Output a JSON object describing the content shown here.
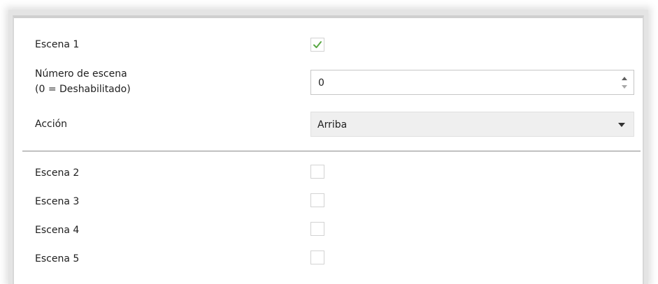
{
  "scenes": {
    "scene1": {
      "label": "Escena 1",
      "checked": true
    },
    "scene2": {
      "label": "Escena 2",
      "checked": false
    },
    "scene3": {
      "label": "Escena 3",
      "checked": false
    },
    "scene4": {
      "label": "Escena 4",
      "checked": false
    },
    "scene5": {
      "label": "Escena 5",
      "checked": false
    }
  },
  "scene_number": {
    "label_line1": "Número de escena",
    "label_line2": "(0 = Deshabilitado)",
    "value": "0"
  },
  "action": {
    "label": "Acción",
    "selected": "Arriba"
  },
  "icons": {
    "check": "checkmark-icon",
    "spin_up": "spin-up-icon",
    "spin_down": "spin-down-icon",
    "dropdown": "chevron-down-icon"
  },
  "colors": {
    "check_green": "#5aa845",
    "select_bg": "#efefef",
    "divider": "#8a8a8a"
  }
}
